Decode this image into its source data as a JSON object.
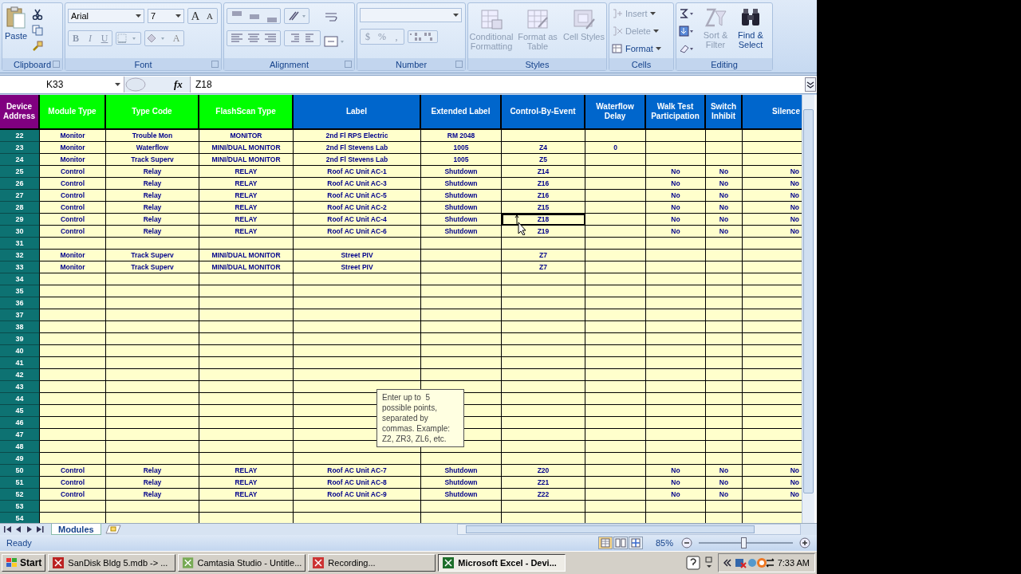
{
  "ribbon": {
    "clipboard": {
      "label": "Clipboard",
      "paste": "Paste"
    },
    "font": {
      "label": "Font",
      "font_name": "Arial",
      "font_size": "7",
      "grow": "A",
      "shrink": "A",
      "style_buttons": [
        {
          "text": "B",
          "kind": "bold",
          "disabled": true
        },
        {
          "text": "I",
          "kind": "italic",
          "disabled": true
        },
        {
          "text": "U",
          "kind": "underline",
          "disabled": true
        }
      ],
      "font_color": "A"
    },
    "alignment": {
      "label": "Alignment"
    },
    "number": {
      "label": "Number",
      "currency": "$",
      "percent": "%",
      "comma": ","
    },
    "styles": {
      "label": "Styles",
      "buttons": [
        {
          "label": "Conditional Formatting",
          "kind": "conditional",
          "disabled": true
        },
        {
          "label": "Format as Table",
          "kind": "table",
          "disabled": true
        },
        {
          "label": "Cell Styles",
          "kind": "styles",
          "disabled": true
        }
      ]
    },
    "cells": {
      "label": "Cells",
      "buttons": [
        {
          "label": "Insert",
          "kind": "insert",
          "disabled": true
        },
        {
          "label": "Delete",
          "kind": "delete",
          "disabled": true
        },
        {
          "label": "Format",
          "kind": "format",
          "disabled": false
        }
      ]
    },
    "editing": {
      "label": "Editing",
      "buttons": [
        {
          "label": "Sort & Filter",
          "kind": "sort",
          "disabled": true
        },
        {
          "label": "Find & Select",
          "kind": "find",
          "disabled": false
        }
      ]
    }
  },
  "formula_bar": {
    "name_box": "K33",
    "function_button": "fx",
    "formula": "Z18"
  },
  "sheet": {
    "columns": [
      {
        "label": "Device Address",
        "color": "#800080"
      },
      {
        "label": "Module Type",
        "color": "#00ff00"
      },
      {
        "label": "Type Code",
        "color": "#00ff00"
      },
      {
        "label": "FlashScan Type",
        "color": "#00ff00"
      },
      {
        "label": "Label",
        "color": "#0066cc"
      },
      {
        "label": "Extended Label",
        "color": "#0066cc"
      },
      {
        "label": "Control-By-Event",
        "color": "#0066cc"
      },
      {
        "label": "Waterflow Delay",
        "color": "#0066cc"
      },
      {
        "label": "Walk Test Participation",
        "color": "#0066cc"
      },
      {
        "label": "Switch Inhibit",
        "color": "#0066cc"
      },
      {
        "label": "Silence",
        "color": "#0066cc"
      }
    ],
    "rows": [
      {
        "address": "22",
        "cells": [
          "Monitor",
          "Trouble Mon",
          "MONITOR",
          "2nd Fl RPS Electric",
          "RM 2048"
        ]
      },
      {
        "address": "23",
        "cells": [
          "Monitor",
          "Waterflow",
          "MINI/DUAL MONITOR",
          "2nd Fl Stevens Lab",
          "1005",
          "Z4",
          "0"
        ]
      },
      {
        "address": "24",
        "cells": [
          "Monitor",
          "Track Superv",
          "MINI/DUAL MONITOR",
          "2nd Fl Stevens Lab",
          "1005",
          "Z5"
        ]
      },
      {
        "address": "25",
        "cells": [
          "Control",
          "Relay",
          "RELAY",
          "Roof AC Unit AC-1",
          "Shutdown",
          "Z14",
          null,
          "No",
          "No",
          "No"
        ]
      },
      {
        "address": "26",
        "cells": [
          "Control",
          "Relay",
          "RELAY",
          "Roof AC Unit AC-3",
          "Shutdown",
          "Z16",
          null,
          "No",
          "No",
          "No"
        ]
      },
      {
        "address": "27",
        "cells": [
          "Control",
          "Relay",
          "RELAY",
          "Roof AC Unit AC-5",
          "Shutdown",
          "Z16",
          null,
          "No",
          "No",
          "No"
        ]
      },
      {
        "address": "28",
        "cells": [
          "Control",
          "Relay",
          "RELAY",
          "Roof AC Unit AC-2",
          "Shutdown",
          "Z15",
          null,
          "No",
          "No",
          "No"
        ]
      },
      {
        "address": "29",
        "cells": [
          "Control",
          "Relay",
          "RELAY",
          "Roof AC Unit AC-4",
          "Shutdown",
          {
            "text": "Z18",
            "selected": true
          },
          null,
          "No",
          "No",
          "No"
        ]
      },
      {
        "address": "30",
        "cells": [
          "Control",
          "Relay",
          "RELAY",
          "Roof AC Unit AC-6",
          "Shutdown",
          "Z19",
          null,
          "No",
          "No",
          "No"
        ]
      },
      {
        "address": "31"
      },
      {
        "address": "32",
        "cells": [
          "Monitor",
          "Track Superv",
          "MINI/DUAL MONITOR",
          "Street PIV",
          null,
          "Z7"
        ]
      },
      {
        "address": "33",
        "cells": [
          "Monitor",
          "Track Superv",
          "MINI/DUAL MONITOR",
          "Street PIV",
          null,
          "Z7"
        ]
      },
      {
        "address": "34"
      },
      {
        "address": "35"
      },
      {
        "address": "36"
      },
      {
        "address": "37"
      },
      {
        "address": "38"
      },
      {
        "address": "39"
      },
      {
        "address": "40"
      },
      {
        "address": "41"
      },
      {
        "address": "42"
      },
      {
        "address": "43"
      },
      {
        "address": "44"
      },
      {
        "address": "45"
      },
      {
        "address": "46"
      },
      {
        "address": "47"
      },
      {
        "address": "48"
      },
      {
        "address": "49"
      },
      {
        "address": "50",
        "cells": [
          "Control",
          "Relay",
          "RELAY",
          "Roof AC Unit AC-7",
          "Shutdown",
          "Z20",
          null,
          "No",
          "No",
          "No"
        ]
      },
      {
        "address": "51",
        "cells": [
          "Control",
          "Relay",
          "RELAY",
          "Roof AC Unit AC-8",
          "Shutdown",
          "Z21",
          null,
          "No",
          "No",
          "No"
        ]
      },
      {
        "address": "52",
        "cells": [
          "Control",
          "Relay",
          "RELAY",
          "Roof AC Unit AC-9",
          "Shutdown",
          "Z22",
          null,
          "No",
          "No",
          "No"
        ]
      },
      {
        "address": "53"
      },
      {
        "address": "54"
      }
    ],
    "comment": {
      "text": "Enter up to  5 possible points, separated by commas. Example: Z2, ZR3, ZL6, etc."
    }
  },
  "sheet_tabs": [
    {
      "label": "Modules",
      "selected": true
    }
  ],
  "status_bar": {
    "status": "Ready",
    "views": [
      {
        "kind": "normal",
        "selected": true
      },
      {
        "kind": "page_layout",
        "selected": false
      },
      {
        "kind": "page_break",
        "selected": false
      }
    ],
    "zoom": "85%",
    "zoom_slider": {
      "level": 0.45
    }
  },
  "taskbar": {
    "start": "Start",
    "tasks": [
      {
        "label": "SanDisk Bldg 5.mdb  -> ...",
        "kind": "database",
        "selected": false
      },
      {
        "label": "Camtasia Studio - Untitle...",
        "kind": "camtasia",
        "selected": false
      },
      {
        "label": "Recording...",
        "kind": "recorder",
        "selected": false
      },
      {
        "label": "Microsoft Excel - Devi...",
        "kind": "excel",
        "selected": true
      }
    ],
    "clock": "7:33 AM"
  }
}
